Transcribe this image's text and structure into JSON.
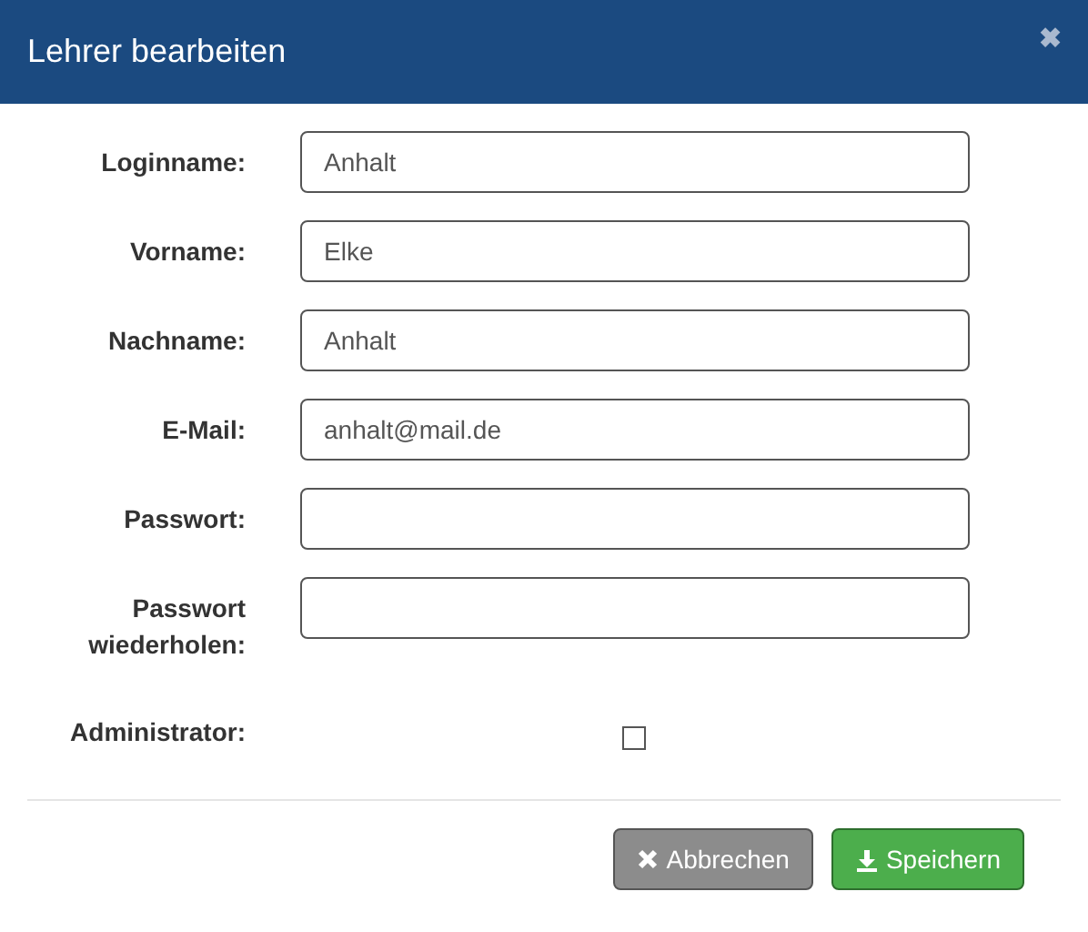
{
  "dialog": {
    "title": "Lehrer bearbeiten",
    "close": "✖"
  },
  "fields": [
    {
      "kind": "text",
      "label": "Loginname:",
      "value": "Anhalt"
    },
    {
      "kind": "text",
      "label": "Vorname:",
      "value": "Elke"
    },
    {
      "kind": "text",
      "label": "Nachname:",
      "value": "Anhalt"
    },
    {
      "kind": "text",
      "label": "E-Mail:",
      "value": "anhalt@mail.de"
    },
    {
      "kind": "text",
      "label": "Passwort:"
    },
    {
      "kind": "text",
      "label": "Passwort wiederholen:"
    },
    {
      "kind": "checkbox",
      "label": "Administrator:",
      "checked": false
    }
  ],
  "buttons": [
    {
      "kind": "cancel",
      "label": "Abbrechen"
    },
    {
      "kind": "save",
      "label": "Speichern"
    }
  ]
}
